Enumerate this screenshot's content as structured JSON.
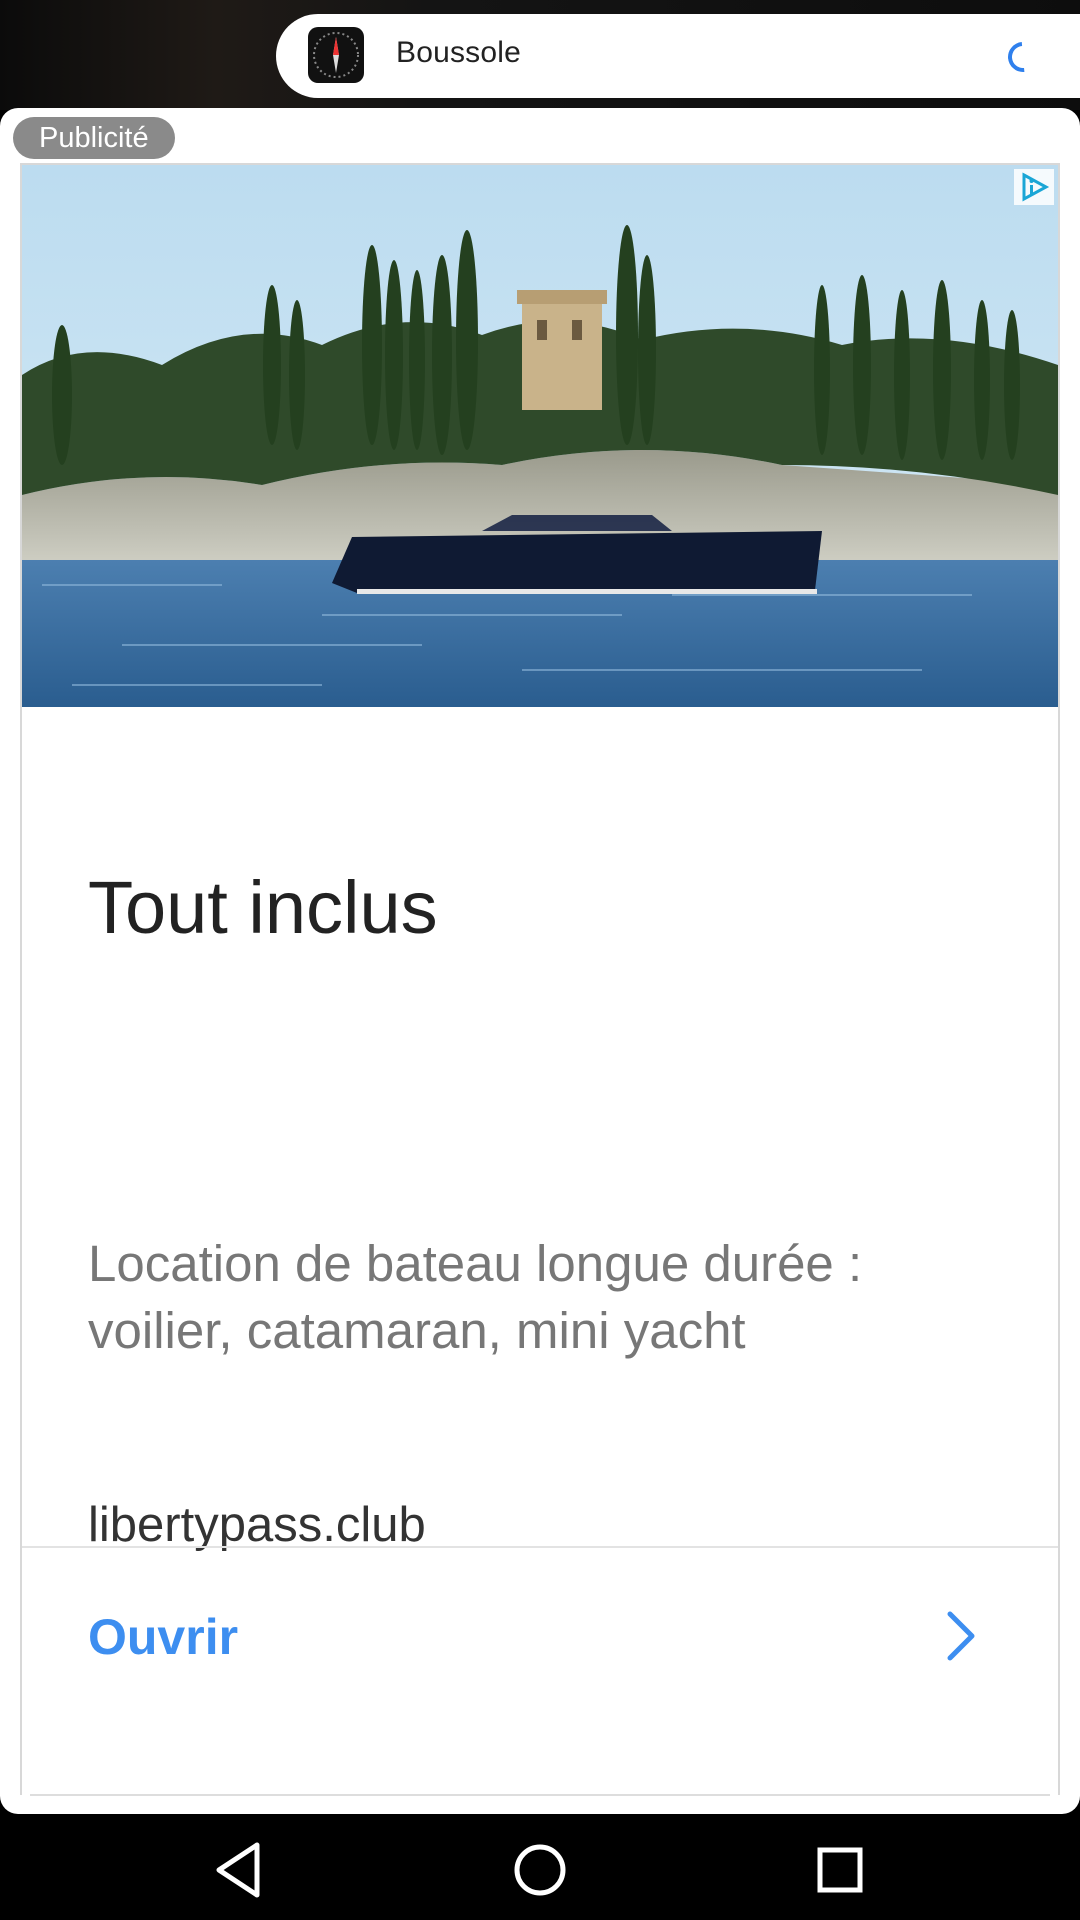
{
  "app": {
    "name": "Boussole",
    "icon": "compass-app-icon"
  },
  "ad": {
    "badge": "Publicité",
    "adchoices_icon": "adchoices-icon",
    "image_alt": "boat-on-lake-image",
    "title": "Tout inclus",
    "description": "Location de bateau longue durée : voilier, catamaran, mini yacht",
    "domain": "libertypass.club",
    "cta_label": "Ouvrir",
    "cta_color": "#3d8ef0"
  },
  "navbar": {
    "back_icon": "back-triangle-icon",
    "home_icon": "home-circle-icon",
    "recents_icon": "recents-square-icon"
  }
}
